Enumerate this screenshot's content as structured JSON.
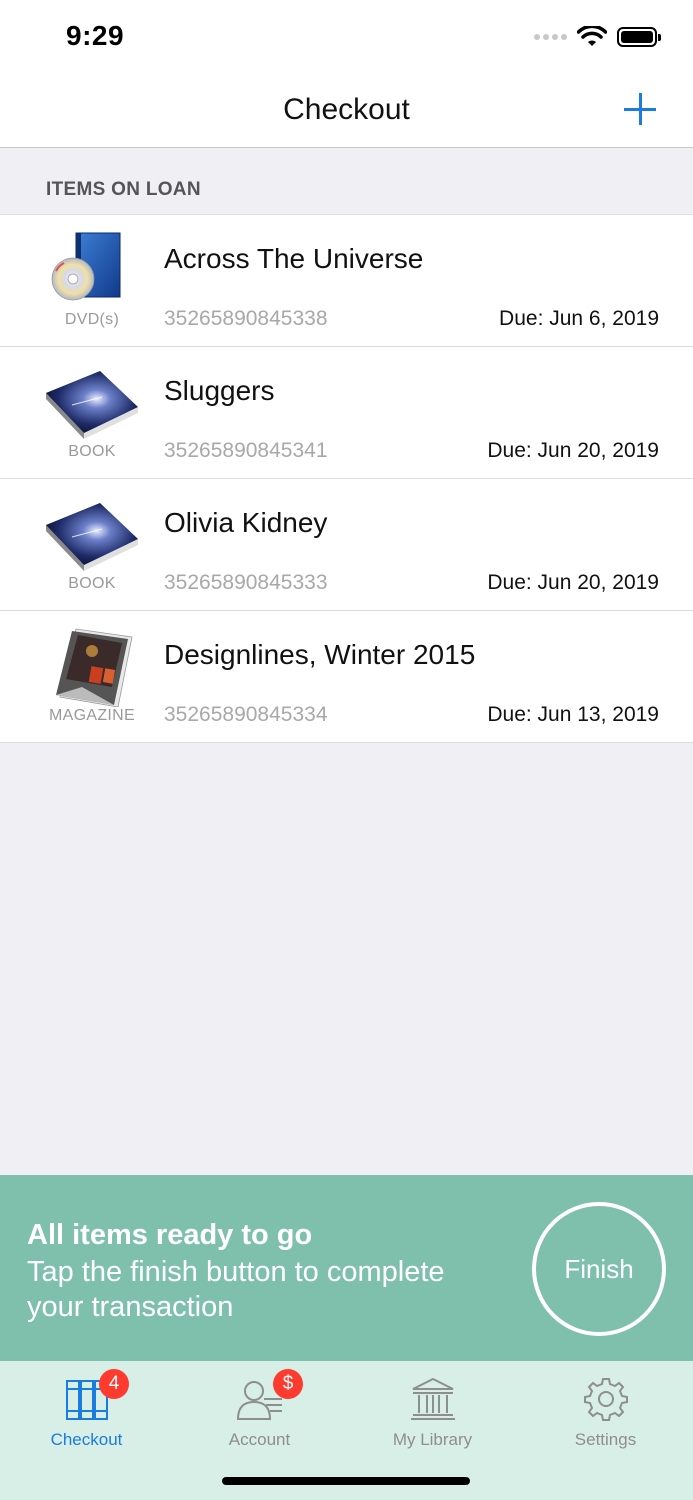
{
  "status_bar": {
    "time": "9:29"
  },
  "nav": {
    "title": "Checkout"
  },
  "section": {
    "header": "ITEMS ON LOAN"
  },
  "items": [
    {
      "title": "Across The Universe",
      "type": "DVD(s)",
      "barcode": "35265890845338",
      "due": "Due: Jun 6, 2019",
      "icon": "dvd-icon"
    },
    {
      "title": "Sluggers",
      "type": "BOOK",
      "barcode": "35265890845341",
      "due": "Due: Jun 20, 2019",
      "icon": "book-icon"
    },
    {
      "title": "Olivia Kidney",
      "type": "BOOK",
      "barcode": "35265890845333",
      "due": "Due: Jun 20, 2019",
      "icon": "book-icon"
    },
    {
      "title": "Designlines, Winter 2015",
      "type": "MAGAZINE",
      "barcode": "35265890845334",
      "due": "Due: Jun 13, 2019",
      "icon": "magazine-icon"
    }
  ],
  "banner": {
    "heading": "All items ready to go",
    "text": "Tap the finish button to complete your transaction",
    "finish_label": "Finish",
    "color": "#7fc0ad"
  },
  "tabs": [
    {
      "label": "Checkout",
      "badge": "4",
      "active": true,
      "icon": "books-icon"
    },
    {
      "label": "Account",
      "badge": "$",
      "active": false,
      "icon": "account-icon"
    },
    {
      "label": "My Library",
      "badge": "",
      "active": false,
      "icon": "library-icon"
    },
    {
      "label": "Settings",
      "badge": "",
      "active": false,
      "icon": "gear-icon"
    }
  ],
  "colors": {
    "accent": "#1a7be0",
    "badge": "#ff3b30",
    "tab_bar": "#d8efe8"
  }
}
